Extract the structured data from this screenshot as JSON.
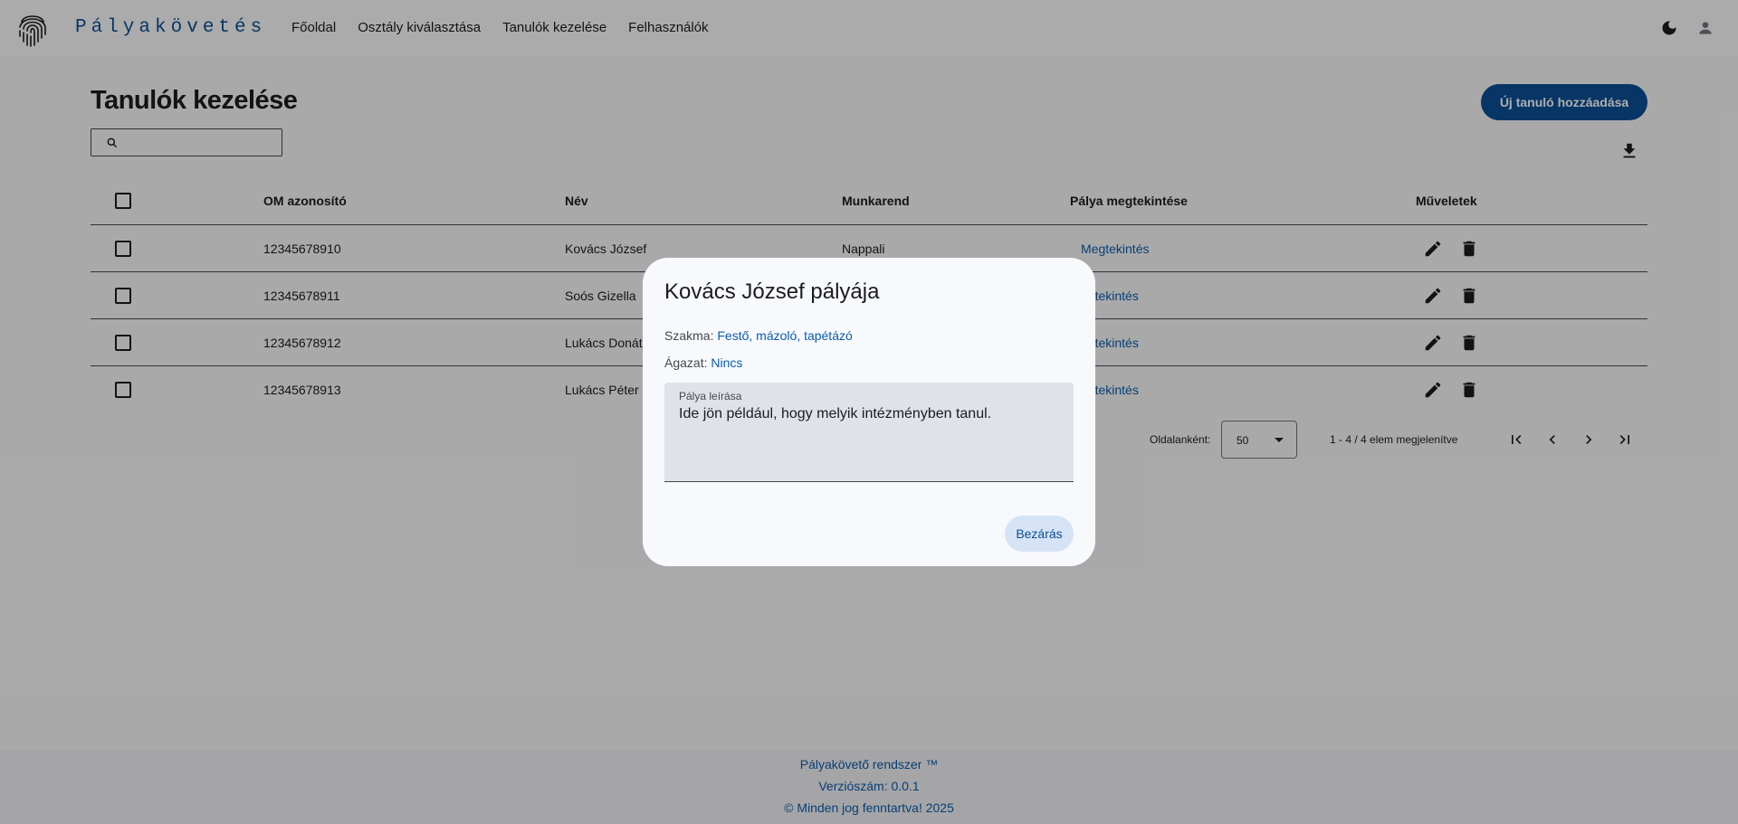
{
  "header": {
    "brand": "Pályakövetés",
    "nav": [
      "Főoldal",
      "Osztály kiválasztása",
      "Tanulók kezelése",
      "Felhasználók"
    ],
    "icons": {
      "logo": "fingerprint-icon",
      "theme": "dark-mode-icon",
      "account": "account-icon"
    }
  },
  "page": {
    "title": "Tanulók kezelése",
    "search_placeholder": "",
    "add_button": "Új tanuló hozzáadása"
  },
  "table": {
    "headers": {
      "om": "OM azonosító",
      "nev": "Név",
      "munkarend": "Munkarend",
      "palya": "Pálya megtekintése",
      "muveletek": "Műveletek"
    },
    "rows": [
      {
        "om": "12345678910",
        "nev": "Kovács József",
        "munkarend": "Nappali",
        "link": "Megtekintés"
      },
      {
        "om": "12345678911",
        "nev": "Soós Gizella",
        "munkarend": "",
        "link": "egtekintés"
      },
      {
        "om": "12345678912",
        "nev": "Lukács Donát",
        "munkarend": "",
        "link": "egtekintés"
      },
      {
        "om": "12345678913",
        "nev": "Lukács Péter",
        "munkarend": "",
        "link": "egtekintés"
      }
    ]
  },
  "paginator": {
    "label": "Oldalanként:",
    "page_size": "50",
    "range": "1 - 4 / 4 elem megjelenítve"
  },
  "footer": {
    "line1": "Pályakövető rendszer ™",
    "line2": "Verziószám: 0.0.1",
    "line3": "© Minden jog fenntartva! 2025"
  },
  "dialog": {
    "title": "Kovács József pályája",
    "szakma_label": "Szakma:",
    "szakma_value": "Festő, mázoló, tapétázó",
    "agazat_label": "Ágazat:",
    "agazat_value": "Nincs",
    "textarea_label": "Pálya leírása",
    "textarea_value": "Ide jön például, hogy melyik intézményben tanul.",
    "close_button": "Bezárás"
  },
  "colors": {
    "primary": "#0b4f97",
    "link": "#0b5cad",
    "overlay": "rgba(0,0,0,0.32)"
  }
}
